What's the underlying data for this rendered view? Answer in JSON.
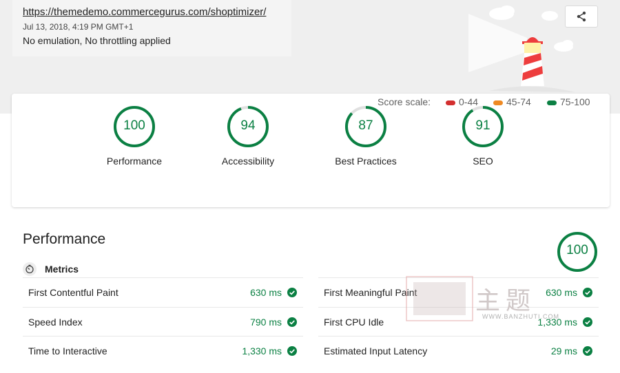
{
  "header": {
    "url": "https://themedemo.commercegurus.com/shoptimizer/",
    "date": "Jul 13, 2018, 4:19 PM GMT+1",
    "emulation": "No emulation, No throttling applied",
    "share_icon": "share-icon"
  },
  "scores": [
    {
      "label": "Performance",
      "value": "100",
      "fraction": 1.0
    },
    {
      "label": "Accessibility",
      "value": "94",
      "fraction": 0.94
    },
    {
      "label": "Best Practices",
      "value": "87",
      "fraction": 0.87
    },
    {
      "label": "SEO",
      "value": "91",
      "fraction": 0.91
    }
  ],
  "scale": {
    "label": "Score scale:",
    "ranges": [
      {
        "text": "0-44",
        "color": "#d32f2f"
      },
      {
        "text": "45-74",
        "color": "#ef8a23"
      },
      {
        "text": "75-100",
        "color": "#0b8043"
      }
    ]
  },
  "performance": {
    "title": "Performance",
    "score": "100",
    "metrics_label": "Metrics",
    "metrics_left": [
      {
        "name": "First Contentful Paint",
        "value": "630 ms"
      },
      {
        "name": "Speed Index",
        "value": "790 ms"
      },
      {
        "name": "Time to Interactive",
        "value": "1,330 ms"
      }
    ],
    "metrics_right": [
      {
        "name": "First Meaningful Paint",
        "value": "630 ms"
      },
      {
        "name": "First CPU Idle",
        "value": "1,330 ms"
      },
      {
        "name": "Estimated Input Latency",
        "value": "29 ms"
      }
    ]
  },
  "watermark": {
    "cn": "主题",
    "url": "WWW.BANZHUTI.COM"
  },
  "colors": {
    "pass": "#0b8043",
    "ring_track": "#e0e0e0"
  }
}
